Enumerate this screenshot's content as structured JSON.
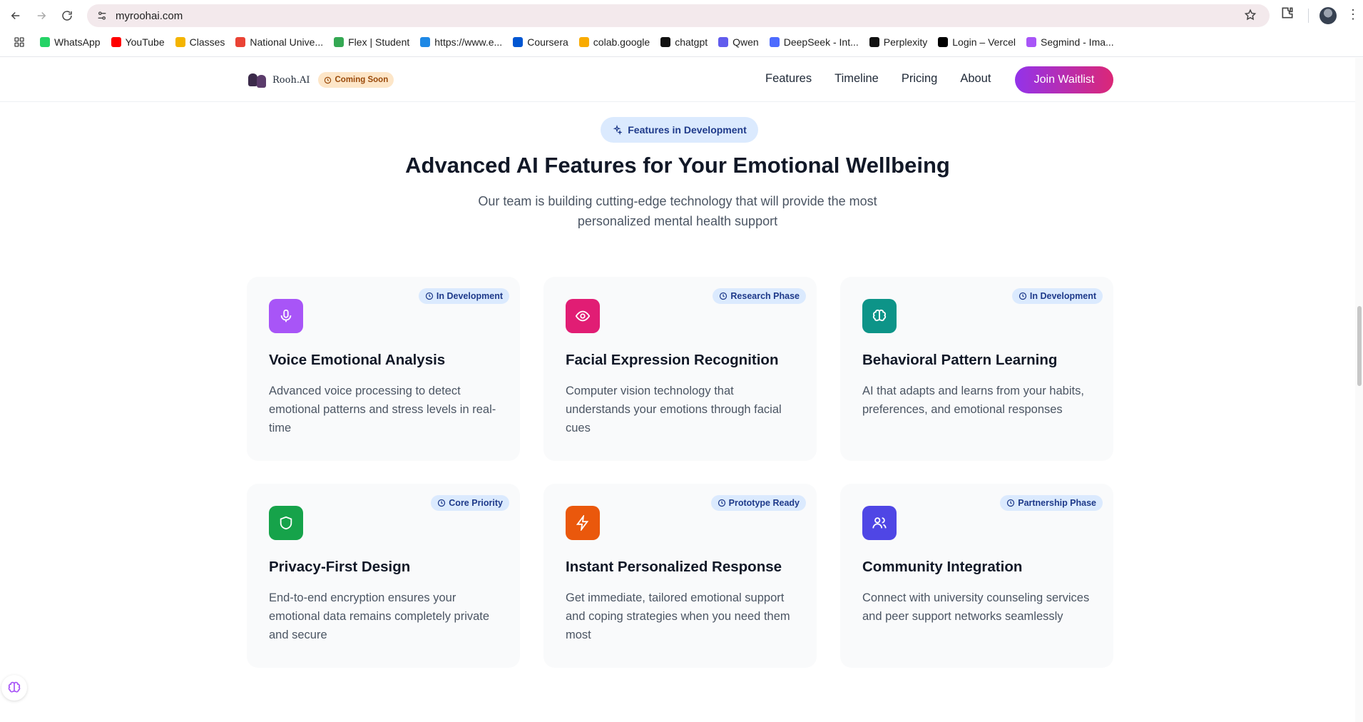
{
  "browser": {
    "url": "myroohai.com",
    "bookmarks": [
      {
        "label": "WhatsApp",
        "color": "#25d366"
      },
      {
        "label": "YouTube",
        "color": "#ff0000"
      },
      {
        "label": "Classes",
        "color": "#f4b400"
      },
      {
        "label": "National Unive...",
        "color": "#ea4335"
      },
      {
        "label": "Flex | Student",
        "color": "#34a853"
      },
      {
        "label": "https://www.e...",
        "color": "#1e88e5"
      },
      {
        "label": "Coursera",
        "color": "#0056d2"
      },
      {
        "label": "colab.google",
        "color": "#f9ab00"
      },
      {
        "label": "chatgpt",
        "color": "#111111"
      },
      {
        "label": "Qwen",
        "color": "#615ced"
      },
      {
        "label": "DeepSeek - Int...",
        "color": "#4d6bfe"
      },
      {
        "label": "Perplexity",
        "color": "#111111"
      },
      {
        "label": "Login – Vercel",
        "color": "#000000"
      },
      {
        "label": "Segmind - Ima...",
        "color": "#a855f7"
      }
    ]
  },
  "header": {
    "logo_text": "Rooh.AI",
    "coming_soon": "Coming Soon",
    "nav": [
      "Features",
      "Timeline",
      "Pricing",
      "About"
    ],
    "cta": "Join Waitlist"
  },
  "section": {
    "pill": "Features in Development",
    "title": "Advanced AI Features for Your Emotional Wellbeing",
    "subtitle": "Our team is building cutting-edge technology that will provide the most personalized mental health support"
  },
  "features": [
    {
      "badge": "In Development",
      "title": "Voice Emotional Analysis",
      "desc": "Advanced voice processing to detect emotional patterns and stress levels in real-time",
      "icon": "microphone-icon",
      "color": "#a855f7"
    },
    {
      "badge": "Research Phase",
      "title": "Facial Expression Recognition",
      "desc": "Computer vision technology that understands your emotions through facial cues",
      "icon": "eye-icon",
      "color": "#e11d74"
    },
    {
      "badge": "In Development",
      "title": "Behavioral Pattern Learning",
      "desc": "AI that adapts and learns from your habits, preferences, and emotional responses",
      "icon": "brain-icon",
      "color": "#0d9488"
    },
    {
      "badge": "Core Priority",
      "title": "Privacy-First Design",
      "desc": "End-to-end encryption ensures your emotional data remains completely private and secure",
      "icon": "shield-icon",
      "color": "#16a34a"
    },
    {
      "badge": "Prototype Ready",
      "title": "Instant Personalized Response",
      "desc": "Get immediate, tailored emotional support and coping strategies when you need them most",
      "icon": "lightning-icon",
      "color": "#ea580c"
    },
    {
      "badge": "Partnership Phase",
      "title": "Community Integration",
      "desc": "Connect with university counseling services and peer support networks seamlessly",
      "icon": "users-icon",
      "color": "#4f46e5"
    }
  ]
}
